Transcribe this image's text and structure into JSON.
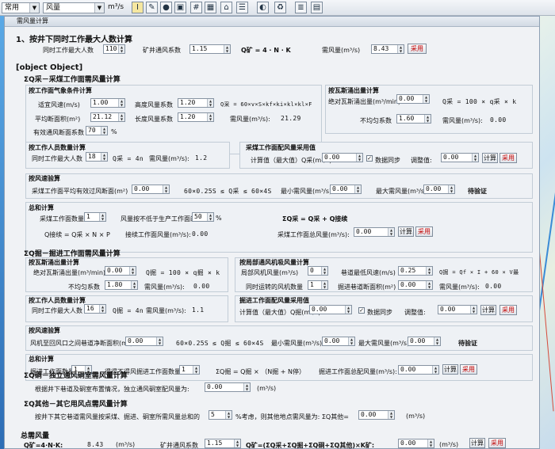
{
  "toolbar": {
    "mode": "常用",
    "source": "风量",
    "unit": "m³/s",
    "icons": [
      "cursor-icon",
      "draw-icon",
      "circle-icon",
      "layers-icon",
      "grid-icon",
      "table-icon",
      "building-icon",
      "list-icon",
      "palette-icon",
      "recycle-icon",
      "report-icon",
      "document-icon"
    ]
  },
  "dialog": {
    "title": "需风量计算"
  },
  "s1": {
    "heading": "1、按井下同时工作最大人数计算",
    "people_label": "同时工作最大人数",
    "people": "110",
    "coef_label": "矿井通风系数",
    "coef": "1.15",
    "formula": "Q矿 = 4 · N · K",
    "q_label": "需风量(m³/s)",
    "q": "8.43",
    "adopt": "采用"
  },
  "s2": {
    "heading": {
      "heading": "ΣQ掘－掘进工作面需风量计算",
      "gas": {
        "heading": "按瓦斯涌出量计算",
        "abs_label": "绝对瓦斯涌出量(m³/min)",
        "abs": "0.00",
        "formula": "Q掘 = 100 × q掘 × k",
        "uneven_label": "不均匀系数",
        "uneven": "1.80",
        "q_label": "需风量(m³/s):",
        "q": "0.00"
      },
      "fan": {
        "heading": "按局部通风机吸风量计算",
        "fan_label": "局部风机风量(m³/s)",
        "fan": "0",
        "speed_label": "巷道最低风速(m/s)",
        "speed": "0.25",
        "formula": "Q掘 = Qf × I + 60 × V最",
        "num_label": "同时运转的风机数量",
        "num": "1",
        "area_label": "掘进巷道断面积(m²)",
        "area": "0.00",
        "q_label": "需风量(m³/s):",
        "q": "0.00"
      },
      "workers": {
        "heading": "按工作人员数量计算",
        "people_label": "同时工作最大人数",
        "people": "16",
        "formula": "Q掘 = 4n",
        "q_label": "需风量(m³/s):",
        "q": "1.1"
      },
      "adopt": {
        "heading": "掘进工作面配风量采用值",
        "calc_label": "计算值（最大值）Q掘(m³/s)",
        "calc": "0.00",
        "sync": "数据同步",
        "adj_label": "调整值:",
        "adj": "0.00",
        "calc_btn": "计算",
        "adopt_btn": "采用"
      },
      "wind": {
        "heading": "按风速验算",
        "label": "风机至回风口之间巷道净断面积(m²)",
        "value": "0.00",
        "formula": "60×0.25S ≤ Q掘 ≤ 60×4S",
        "min_label": "最小需风量(m³/s)",
        "min": "0.00",
        "max_label": "最大需风量(m³/s)",
        "max": "0.00",
        "status": "待验证"
      },
      "total": {
        "heading": "总和计算",
        "count_label": "掘进工作面数量",
        "count": "1",
        "noless_label": "得得不得风掘进工作面数量",
        "noless": "1",
        "formula": "ΣQ掘 = Q掘 × （N掘 + N停）",
        "sum_label": "掘进工作面总配风量(m³/s):",
        "sum": "0.00",
        "calc_btn": "计算",
        "adopt_btn": "采用"
      }
    },
    "mining": {
      "heading": "ΣQ采－采煤工作面需风量计算",
      "weather": {
        "heading": "按工作面气象条件计算",
        "speed_label": "适宜风速(m/s)",
        "speed": "1.00",
        "height_label": "高度风量系数",
        "height": "1.20",
        "formula": "Q采 = 60×v×S×kf×ki×kl×kl×F",
        "area_label": "平均断面积(m²)",
        "area": "21.12",
        "length_label": "长度风量系数",
        "length": "1.20",
        "q_label": "需风量(m³/s):",
        "q": "21.29",
        "eff_label": "有效通风断面系数",
        "eff": "70",
        "percent": "%"
      },
      "gas": {
        "heading": "按瓦斯涌出量计算",
        "abs_label": "绝对瓦斯涌出量(m³/min)",
        "abs": "0.00",
        "formula": "Q采 = 100 × q采 × k",
        "uneven_label": "不均匀系数",
        "uneven": "1.60",
        "q_label": "需风量(m³/s):",
        "q": "0.00"
      },
      "workers": {
        "heading": "按工作人员数量计算",
        "people_label": "同时工作最大人数",
        "people": "18",
        "formula": "Q采 = 4n",
        "q_label": "需风量(m³/s):",
        "q": "1.2"
      },
      "adopt": {
        "heading": "采煤工作面配风量采用值",
        "calc_label": "计算值（最大值）Q采(m³/s)",
        "calc": "0.00",
        "sync": "数据同步",
        "adj_label": "调整值:",
        "adj": "0.00",
        "calc_btn": "计算",
        "adopt_btn": "采用"
      },
      "wind": {
        "heading": "按风速验算",
        "label": "采煤工作面平均有效过风断面(m²)",
        "value": "0.00",
        "formula": "60×0.25S ≤ Q采 ≤ 60×4S",
        "min_label": "最小需风量(m³/s)",
        "min": "0.00",
        "max_label": "最大需风量(m³/s)",
        "max": "0.00",
        "status": "待验证"
      },
      "total": {
        "heading": "总和计算",
        "count_label": "采煤工作面数量",
        "count": "1",
        "ratio_label": "风量按不低于生产工作面的",
        "ratio": "50",
        "percent": "%",
        "formula1": "ΣQ采 = Q采 + Q接续",
        "formula2": "Q接续 = Q采 × N × P",
        "cont_label": "接续工作面风量(m³/s):",
        "cont": "0.00",
        "sum_label": "采煤工作面总风量(m³/s):",
        "sum": "0.00",
        "calc_btn": "计算",
        "adopt_btn": "采用"
      }
    },
    "chamber": {
      "heading": "ΣQ硐－独立通风硐室需风量计算",
      "label": "根据井下巷道及硐室布置情况，独立通风硐室配风量为:",
      "value": "0.00",
      "unit": "(m³/s)"
    },
    "other": {
      "heading": "ΣQ其他－其它用风点需风量计算",
      "label_a": "按井下其它巷道需风量按采煤、掘进、硐室所需风量总和的",
      "value": "5",
      "label_b": "%考虑，则其他地点需风量为: ΣQ其他=",
      "result": "0.00",
      "unit": "(m³/s)"
    }
  },
  "total": {
    "heading": "总需风量",
    "f1": "Q矿=4·N·K:",
    "v1": "8.43",
    "u1": "(m³/s)",
    "coef_label": "矿井通风系数",
    "coef": "1.15",
    "f2": "Q矿=(ΣQ采+ΣQ掘+ΣQ硐+ΣQ其他)×K矿:",
    "v2": "0.00",
    "u2": "(m³/s)",
    "calc_btn": "计算",
    "adopt_btn": "采用"
  }
}
